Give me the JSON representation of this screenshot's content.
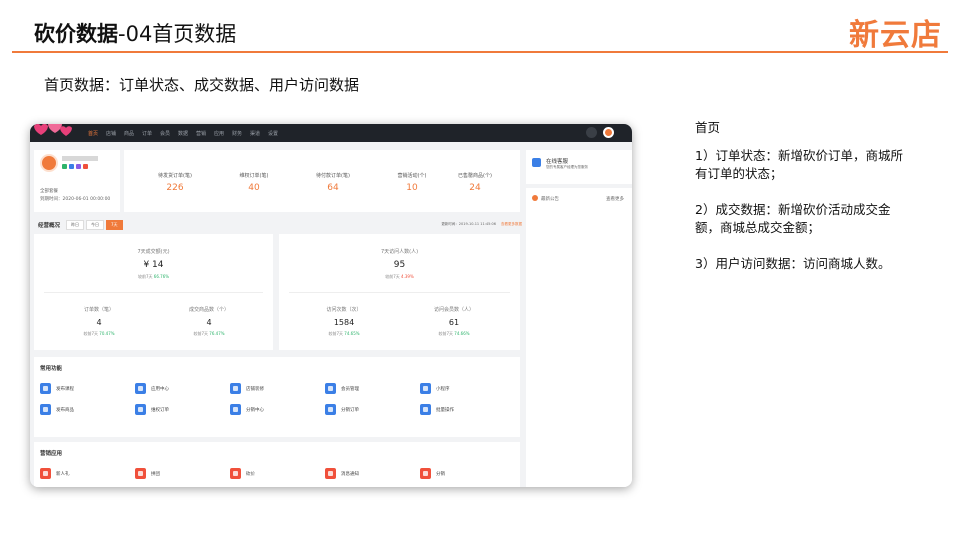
{
  "slide": {
    "title_bold": "砍价数据",
    "title_rest": "-04首页数据",
    "brand": "新云店",
    "subtitle": "首页数据：订单状态、成交数据、用户访问数据"
  },
  "notes": {
    "heading": "首页",
    "item1": "1）订单状态：新增砍价订单，商城所有订单的状态；",
    "item2": "2）成交数据：新增砍价活动成交金额，商城总成交金额；",
    "item3": "3）用户访问数据：访问商城人数。"
  },
  "app": {
    "nav": [
      "首页",
      "店铺",
      "商品",
      "订单",
      "会员",
      "数据",
      "营销",
      "应用",
      "财务",
      "渠道",
      "设置"
    ],
    "shop": {
      "name": "████████",
      "line1": "全部套餐",
      "line2": "到期时间：2020-06-01 00:00:00"
    },
    "order_stats": [
      {
        "label": "待发货订单(笔)",
        "value": "226"
      },
      {
        "label": "维权订单(笔)",
        "value": "40"
      },
      {
        "label": "待付款订单(笔)",
        "value": "64"
      },
      {
        "label": "营销活动(个)",
        "value": "10"
      },
      {
        "label": "已售罄商品(个)",
        "value": "24"
      }
    ],
    "service": {
      "title": "在线客服",
      "sub": "您的专属客户经理为您服务"
    },
    "notice": {
      "title": "最新公告",
      "more": "查看更多"
    },
    "overview": {
      "title": "经营概况",
      "tabs": [
        "昨日",
        "今日",
        "7天"
      ],
      "update": "更新时间：2019-10-11 11:45:06",
      "more": "查看更多数据",
      "sales_label": "7天成交额(元)",
      "sales_value": "¥ 14",
      "sales_cmp": "较前7天",
      "sales_pct": "66.76%",
      "visitors_label": "7天访问人数(人)",
      "visitors_value": "95",
      "visitors_cmp": "较前7天",
      "visitors_pct": "4.39%",
      "orders_label": "订单数（笔）",
      "orders_value": "4",
      "orders_pct": "70.47%",
      "goods_label": "成交商品数（个）",
      "goods_value": "4",
      "goods_pct": "76.47%",
      "visits_label": "访问次数（次）",
      "visits_value": "1584",
      "visits_pct": "74.65%",
      "members_label": "访问会员数（人）",
      "members_value": "61",
      "members_pct": "74.66%",
      "cmp_prefix": "较前7天"
    },
    "common": {
      "title": "常用功能",
      "items": [
        "发布课程",
        "应用中心",
        "店铺装修",
        "会员管理",
        "小程序",
        "发布商品",
        "维权订单",
        "分销中心",
        "分销订单",
        "批量操作"
      ]
    },
    "marketing": {
      "title": "营销应用",
      "items": [
        "新人礼",
        "拼团",
        "砍价",
        "消息通知",
        "分销"
      ]
    }
  }
}
